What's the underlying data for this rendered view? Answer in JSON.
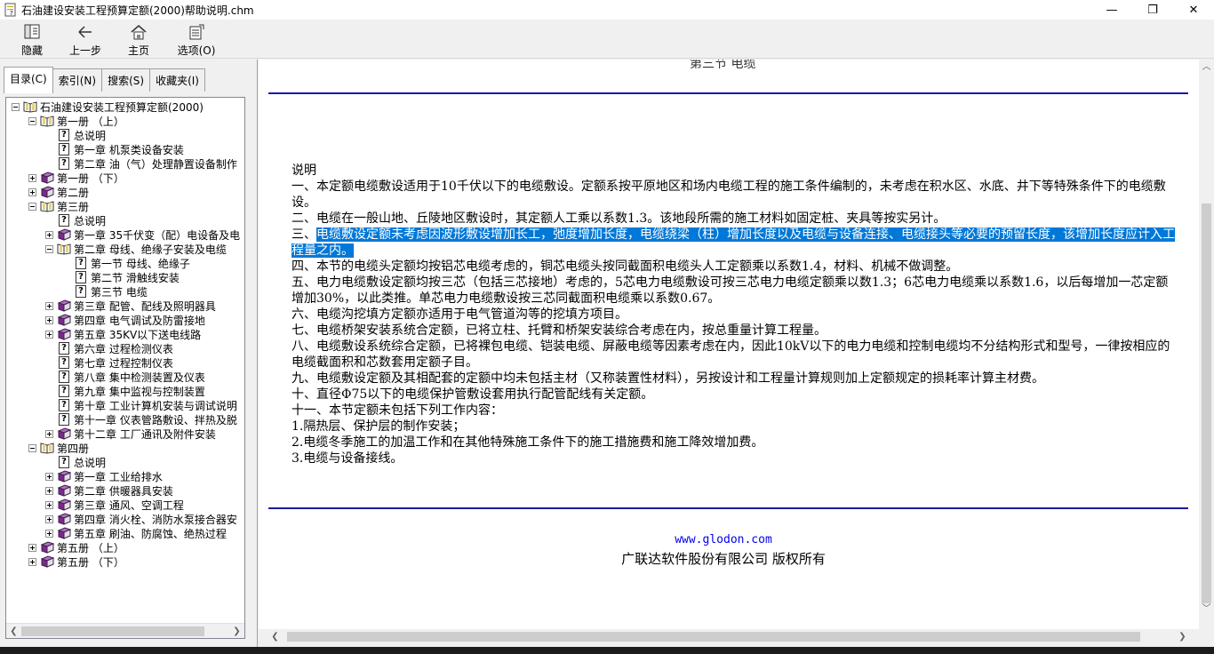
{
  "window": {
    "title": "石油建设安装工程预算定额(2000)帮助说明.chm",
    "minimize": "—",
    "restore": "❐",
    "close": "✕"
  },
  "toolbar": {
    "hide": "隐藏",
    "back": "上一步",
    "home": "主页",
    "options": "选项(O)"
  },
  "tabs": {
    "contents": "目录(C)",
    "index": "索引(N)",
    "search": "搜索(S)",
    "favorites": "收藏夹(I)"
  },
  "tree": [
    {
      "label": "石油建设安装工程预算定额(2000)",
      "level": 0,
      "exp": "minus",
      "icon": "book-open"
    },
    {
      "label": "第一册 （上）",
      "level": 1,
      "exp": "minus",
      "icon": "book-open"
    },
    {
      "label": "总说明",
      "level": 2,
      "exp": "none",
      "icon": "help"
    },
    {
      "label": "第一章 机泵类设备安装",
      "level": 2,
      "exp": "none",
      "icon": "help"
    },
    {
      "label": "第二章 油（气）处理静置设备制作",
      "level": 2,
      "exp": "none",
      "icon": "help"
    },
    {
      "label": "第一册 （下）",
      "level": 1,
      "exp": "plus",
      "icon": "book-closed"
    },
    {
      "label": "第二册",
      "level": 1,
      "exp": "plus",
      "icon": "book-closed"
    },
    {
      "label": "第三册",
      "level": 1,
      "exp": "minus",
      "icon": "book-open"
    },
    {
      "label": "总说明",
      "level": 2,
      "exp": "none",
      "icon": "help"
    },
    {
      "label": "第一章 35千伏变（配）电设备及电",
      "level": 2,
      "exp": "plus",
      "icon": "book-closed"
    },
    {
      "label": "第二章 母线、绝缘子安装及电缆",
      "level": 2,
      "exp": "minus",
      "icon": "book-open"
    },
    {
      "label": "第一节 母线、绝缘子",
      "level": 3,
      "exp": "none",
      "icon": "help"
    },
    {
      "label": "第二节 滑触线安装",
      "level": 3,
      "exp": "none",
      "icon": "help"
    },
    {
      "label": "第三节 电缆",
      "level": 3,
      "exp": "none",
      "icon": "help"
    },
    {
      "label": "第三章 配管、配线及照明器具",
      "level": 2,
      "exp": "plus",
      "icon": "book-closed"
    },
    {
      "label": "第四章 电气调试及防雷接地",
      "level": 2,
      "exp": "plus",
      "icon": "book-closed"
    },
    {
      "label": "第五章 35KV以下送电线路",
      "level": 2,
      "exp": "plus",
      "icon": "book-closed"
    },
    {
      "label": "第六章 过程检测仪表",
      "level": 2,
      "exp": "none",
      "icon": "help"
    },
    {
      "label": "第七章 过程控制仪表",
      "level": 2,
      "exp": "none",
      "icon": "help"
    },
    {
      "label": "第八章 集中检测装置及仪表",
      "level": 2,
      "exp": "none",
      "icon": "help"
    },
    {
      "label": "第九章 集中监视与控制装置",
      "level": 2,
      "exp": "none",
      "icon": "help"
    },
    {
      "label": "第十章 工业计算机安装与调试说明",
      "level": 2,
      "exp": "none",
      "icon": "help"
    },
    {
      "label": "第十一章 仪表管路敷设、拌热及脱",
      "level": 2,
      "exp": "none",
      "icon": "help"
    },
    {
      "label": "第十二章 工厂通讯及附件安装",
      "level": 2,
      "exp": "plus",
      "icon": "book-closed"
    },
    {
      "label": "第四册",
      "level": 1,
      "exp": "minus",
      "icon": "book-open"
    },
    {
      "label": "总说明",
      "level": 2,
      "exp": "none",
      "icon": "help"
    },
    {
      "label": "第一章 工业给排水",
      "level": 2,
      "exp": "plus",
      "icon": "book-closed"
    },
    {
      "label": "第二章 供暖器具安装",
      "level": 2,
      "exp": "plus",
      "icon": "book-closed"
    },
    {
      "label": "第三章 通风、空调工程",
      "level": 2,
      "exp": "plus",
      "icon": "book-closed"
    },
    {
      "label": "第四章 消火栓、消防水泵接合器安",
      "level": 2,
      "exp": "plus",
      "icon": "book-closed"
    },
    {
      "label": "第五章 刷油、防腐蚀、绝热过程",
      "level": 2,
      "exp": "plus",
      "icon": "book-closed"
    },
    {
      "label": "第五册 （上）",
      "level": 1,
      "exp": "plus",
      "icon": "book-closed"
    },
    {
      "label": "第五册 （下）",
      "level": 1,
      "exp": "plus",
      "icon": "book-closed"
    }
  ],
  "content": {
    "section_title": "第三节 电缆",
    "heading": "说明",
    "p1": "一、本定额电缆敷设适用于10千伏以下的电缆敷设。定额系按平原地区和场内电缆工程的施工条件编制的，未考虑在积水区、水底、井下等特殊条件下的电缆敷设。",
    "p2": "二、电缆在一般山地、丘陵地区敷设时，其定额人工乘以系数1.3。该地段所需的施工材料如固定桩、夹具等按实另计。",
    "p3_prefix": "三、",
    "p3_selected": "电缆敷设定额未考虑因波形敷设增加长工，弛度增加长度，电缆绕梁（柱）增加长度以及电缆与设备连接、电缆接头等必要的预留长度，该增加长度应计入工程量之内。",
    "p4": "四、本节的电缆头定额均按铝芯电缆考虑的，铜芯电缆头按同截面积电缆头人工定额乘以系数1.4，材料、机械不做调整。",
    "p5": "五、电力电缆敷设定额均按三芯（包括三芯接地）考虑的，5芯电力电缆敷设可按三芯电力电缆定额乘以数1.3；6芯电力电缆乘以系数1.6，以后每增加一芯定额增加30%，以此类推。单芯电力电缆敷设按三芯同截面积电缆乘以系数0.67。",
    "p6": "六、电缆沟挖填方定额亦适用于电气管道沟等的挖填方项目。",
    "p7": "七、电缆桥架安装系统合定额，已将立柱、托臂和桥架安装综合考虑在内，按总重量计算工程量。",
    "p8": "八、电缆敷设系统综合定额，已将裸包电缆、铠装电缆、屏蔽电缆等因素考虑在内，因此10kV以下的电力电缆和控制电缆均不分结构形式和型号，一律按相应的电缆截面积和芯数套用定额子目。",
    "p9": "九、电缆敷设定额及其相配套的定额中均未包括主材（又称装置性材料），另按设计和工程量计算规则加上定额规定的损耗率计算主材费。",
    "p10": "十、直径Φ75以下的电缆保护管敷设套用执行配管配线有关定额。",
    "p11": "十一、本节定额未包括下列工作内容：",
    "p12": "1.隔热层、保护层的制作安装；",
    "p13": "2.电缆冬季施工的加温工作和在其他特殊施工条件下的施工措施费和施工降效增加费。",
    "p14": "3.电缆与设备接线。",
    "footer_link": "www.glodon.com",
    "footer_copy": "广联达软件股份有限公司 版权所有"
  },
  "colors": {
    "rule": "#1a1aa0",
    "selection": "#0078d7",
    "link": "#0000ee"
  }
}
